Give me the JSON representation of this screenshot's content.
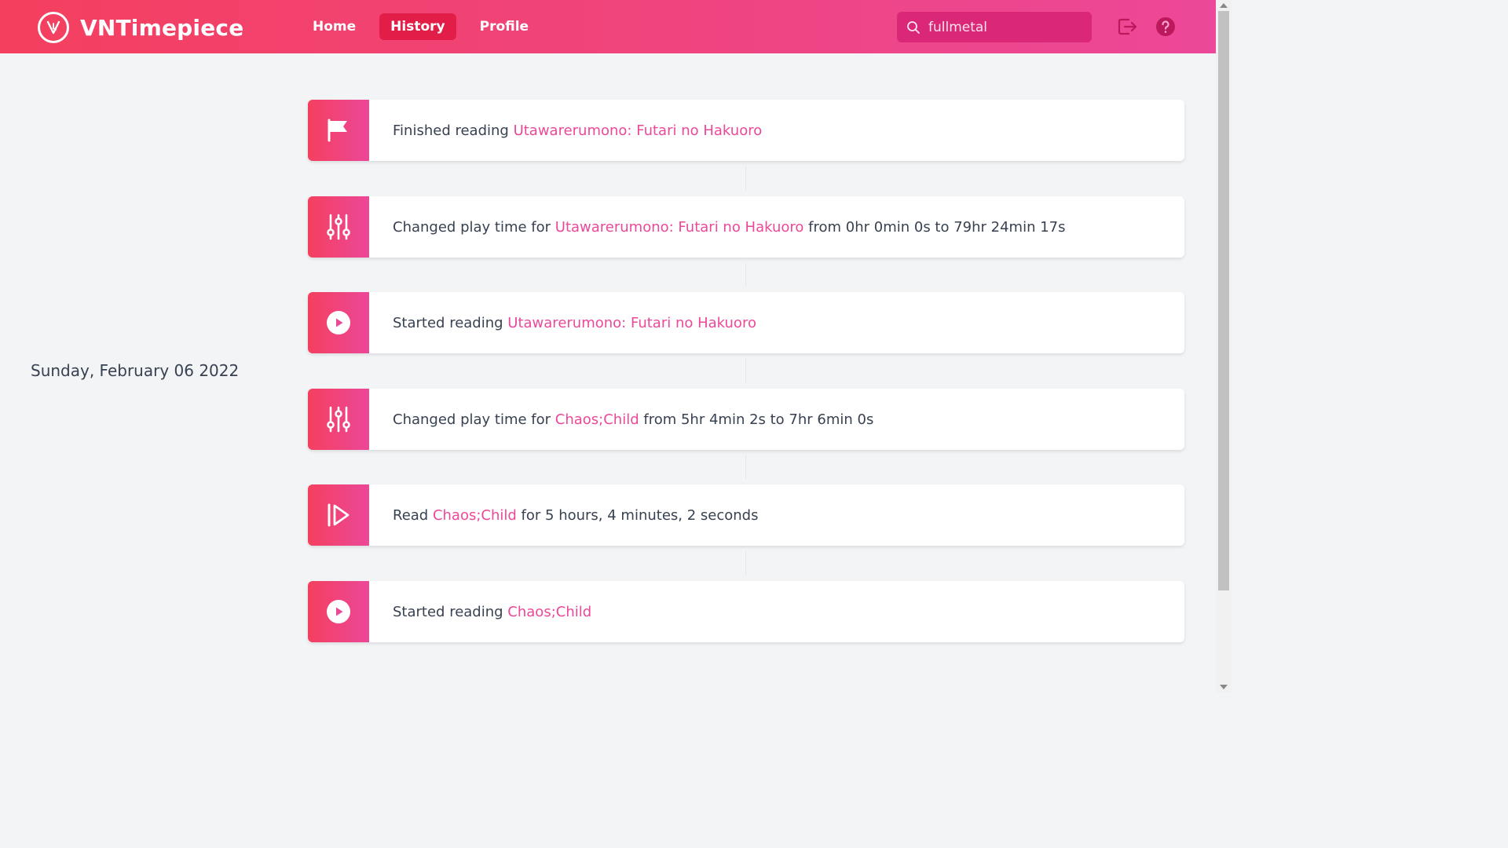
{
  "app": {
    "name": "VNTimepiece"
  },
  "nav": {
    "home": "Home",
    "history": "History",
    "profile": "Profile"
  },
  "search": {
    "value": "fullmetal"
  },
  "colors": {
    "brand_start": "#f43f5e",
    "brand_end": "#ec4899",
    "link": "#ec4899",
    "active_tab": "#e11d48"
  },
  "date": "Sunday, February 06 2022",
  "events": [
    {
      "icon": "flag-icon",
      "prefix": "Finished reading ",
      "title": "Utawarerumono: Futari no Hakuoro",
      "suffix": ""
    },
    {
      "icon": "sliders-icon",
      "prefix": "Changed play time for ",
      "title": "Utawarerumono: Futari no Hakuoro",
      "suffix": " from 0hr 0min 0s to 79hr 24min 17s"
    },
    {
      "icon": "play-circle-icon",
      "prefix": "Started reading ",
      "title": "Utawarerumono: Futari no Hakuoro",
      "suffix": ""
    },
    {
      "icon": "sliders-icon",
      "prefix": "Changed play time for ",
      "title": "Chaos;Child",
      "suffix": " from 5hr 4min 2s to 7hr 6min 0s"
    },
    {
      "icon": "resume-icon",
      "prefix": "Read ",
      "title": "Chaos;Child",
      "suffix": " for 5 hours, 4 minutes, 2 seconds"
    },
    {
      "icon": "play-circle-icon",
      "prefix": "Started reading ",
      "title": "Chaos;Child",
      "suffix": ""
    }
  ]
}
